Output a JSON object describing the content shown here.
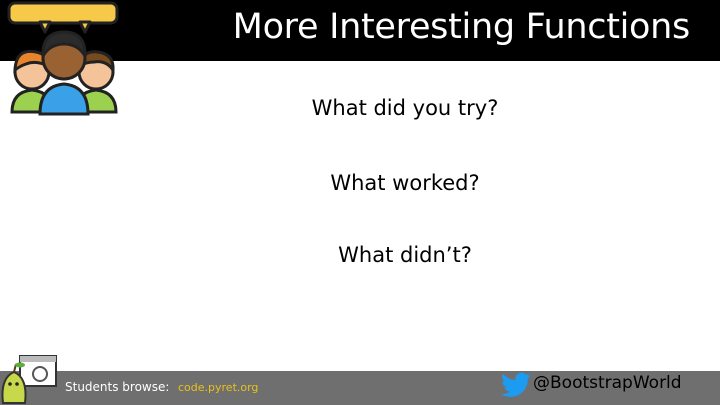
{
  "slide": {
    "title": "More Interesting Functions",
    "prompts": [
      "What did you try?",
      "What worked?",
      "What didn’t?"
    ]
  },
  "footer": {
    "browse_label": "Students browse:",
    "browse_link": "code.pyret.org",
    "twitter_handle": "@BootstrapWorld",
    "license_line1": "",
    "license_line2": ""
  },
  "icons": {
    "group": "people-group-icon",
    "pear": "pyret-pear-icon",
    "twitter": "twitter-bird-icon"
  },
  "colors": {
    "title_bar": "#000000",
    "footer_bar": "#6f6f6f",
    "link": "#e8c21a",
    "twitter_blue": "#1d9bf0"
  }
}
